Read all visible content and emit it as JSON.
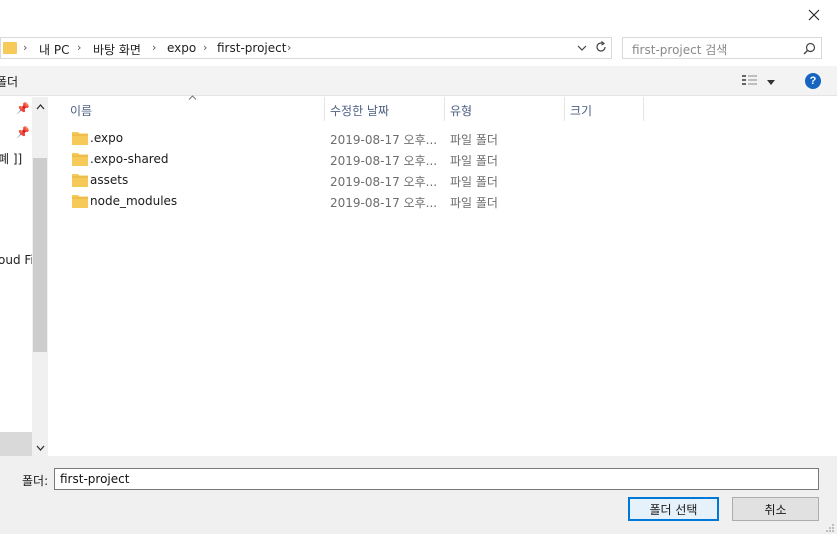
{
  "window": {
    "close_glyph": "✕"
  },
  "address": {
    "breadcrumbs": [
      "내 PC",
      "바탕 화면",
      "expo",
      "first-project"
    ],
    "separator": "›"
  },
  "search": {
    "placeholder": "first-project 검색"
  },
  "toolbar": {
    "left_label": "폴더"
  },
  "nav": {
    "items": [
      "폐 ]]",
      "oud Fil"
    ]
  },
  "columns": {
    "name": "이름",
    "date": "수정한 날짜",
    "type": "유형",
    "size": "크기"
  },
  "files": [
    {
      "name": ".expo",
      "date": "2019-08-17 오후...",
      "type": "파일 폴더"
    },
    {
      "name": ".expo-shared",
      "date": "2019-08-17 오후...",
      "type": "파일 폴더"
    },
    {
      "name": "assets",
      "date": "2019-08-17 오후...",
      "type": "파일 폴더"
    },
    {
      "name": "node_modules",
      "date": "2019-08-17 오후...",
      "type": "파일 폴더"
    }
  ],
  "footer": {
    "folder_label": "폴더:",
    "folder_value": "first-project",
    "select_button": "폴더 선택",
    "cancel_button": "취소"
  },
  "colors": {
    "folder": "#f6ca58",
    "accent": "#0078d7",
    "help": "#1565c0"
  },
  "icons": [
    "close-icon",
    "folder-icon",
    "chevron-down-icon",
    "refresh-icon",
    "search-icon",
    "view-options-icon",
    "help-icon",
    "pin-icon",
    "scroll-up-icon",
    "scroll-down-icon",
    "sort-up-icon"
  ]
}
